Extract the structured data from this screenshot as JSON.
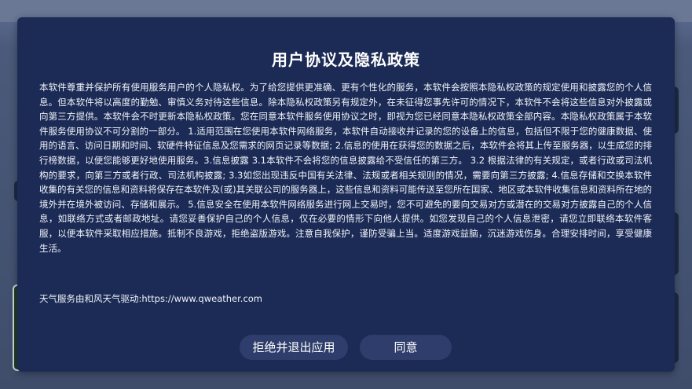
{
  "dialog": {
    "title": "用户协议及隐私政策",
    "body": "本软件尊重并保护所有使用服务用户的个人隐私权。为了给您提供更准确、更有个性化的服务，本软件会按照本隐私权政策的规定使用和披露您的个人信息。但本软件将以高度的勤勉、审慎义务对待这些信息。除本隐私权政策另有规定外，在未征得您事先许可的情况下，本软件不会将这些信息对外披露或向第三方提供。本软件会不时更新本隐私权政策。您在同意本软件服务使用协议之时，即视为您已经同意本隐私权政策全部内容。本隐私权政策属于本软件服务使用协议不可分割的一部分。 1.适用范围在您使用本软件网络服务，本软件自动接收并记录的您的设备上的信息，包括但不限于您的健康数据、使用的语言、访问日期和时间、软硬件特征信息及您需求的网页记录等数据; 2.信息的使用在获得您的数据之后，本软件会将其上传至服务器，以生成您的排行榜数据，以便您能够更好地使用服务。3.信息披露 3.1本软件不会将您的信息披露给不受信任的第三方。 3.2 根据法律的有关规定，或者行政或司法机构的要求，向第三方或者行政、司法机构披露; 3.3如您出现违反中国有关法律、法规或者相关规则的情况，需要向第三方披露; 4.信息存储和交换本软件收集的有关您的信息和资料将保存在本软件及(或)其关联公司的服务器上，这些信息和资料可能传送至您所在国家、地区或本软件收集信息和资料所在地的境外并在境外被访问、存储和展示。 5.信息安全在使用本软件网络服务进行网上交易时，您不可避免的要向交易对方或潜在的交易对方披露自己的个人信息，如联络方式或者邮政地址。请您妥善保护自己的个人信息，仅在必要的情形下向他人提供。如您发现自己的个人信息泄密，请您立即联络本软件客服，以便本软件采取相应措施。抵制不良游戏，拒绝盗版游戏。注意自我保护，谨防受骗上当。适度游戏益脑，沉迷游戏伤身。合理安排时间，享受健康生活。",
    "footer_note": "天气服务由和风天气驱动:https://www.qweather.com",
    "buttons": {
      "reject": "拒绝并退出应用",
      "agree": "同意"
    }
  }
}
